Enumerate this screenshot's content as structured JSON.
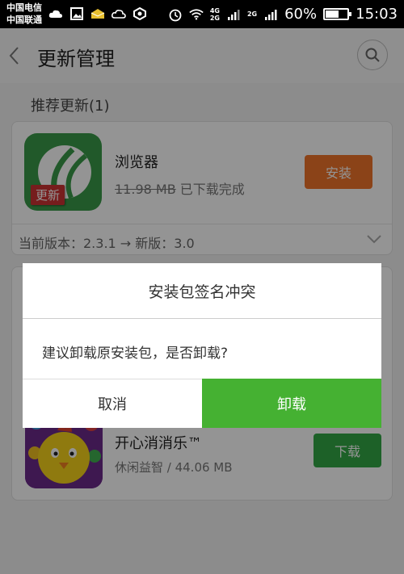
{
  "statusbar": {
    "carrier1": "中国电信",
    "carrier2": "中国联通",
    "net1": "4G",
    "net2": "2G",
    "net3": "2G",
    "battery": "60%",
    "battery_level": 0.6,
    "time": "15:03"
  },
  "header": {
    "title": "更新管理"
  },
  "section": {
    "title": "推荐更新(1)"
  },
  "app1": {
    "badge": "更新",
    "name": "浏览器",
    "old_size": "11.98 MB",
    "status": "已下载完成",
    "action": "安装",
    "version_text": "当前版本：2.3.1 → 新版：3.0"
  },
  "app2": {
    "name": "开心消消乐™",
    "meta": "休闲益智 / 44.06 MB",
    "action": "下载"
  },
  "dialog": {
    "title": "安装包签名冲突",
    "message": "建议卸载原安装包，是否卸载?",
    "cancel": "取消",
    "confirm": "卸载"
  },
  "colors": {
    "install": "#f0742a",
    "download": "#33a845",
    "confirm": "#45b132",
    "badge": "#cc3333"
  }
}
